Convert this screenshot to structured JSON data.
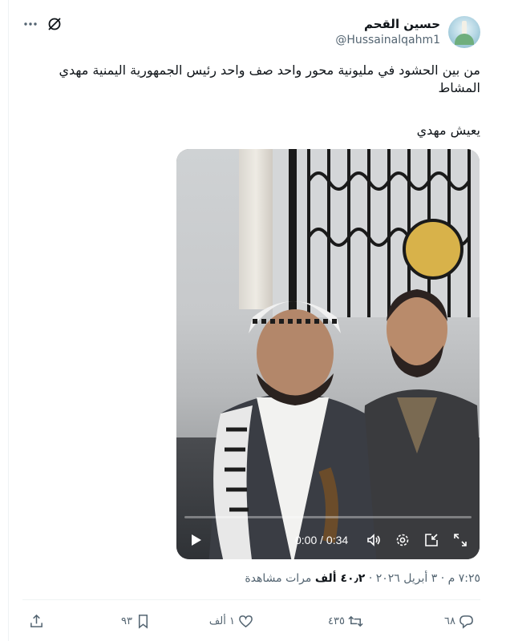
{
  "author": {
    "name": "حسين القحم",
    "handle": "@Hussainalqahm1"
  },
  "post": {
    "text": "من بين الحشود في مليونية محور واحد صف واحد رئيس الجمهورية اليمنية مهدي المشاط",
    "text2": "يعيش مهدي"
  },
  "video": {
    "time": "0:00 / 0:34",
    "progress": 0
  },
  "meta": {
    "timestamp": "٧:٢٥ م · ٣ أبريل ٢٠٢٦ ·",
    "views_count": "٤٠٫٢ ألف",
    "views_label": "مرات مشاهدة"
  },
  "actions": {
    "replies": "٦٨",
    "reposts": "٤٣٥",
    "likes": "١ ألف",
    "bookmarks": "٩٣"
  },
  "icons": [
    "more-icon",
    "grok-icon",
    "play-icon",
    "volume-icon",
    "settings-icon",
    "pip-icon",
    "fullscreen-icon",
    "reply-icon",
    "repost-icon",
    "like-icon",
    "bookmark-icon",
    "share-icon"
  ],
  "colors": {
    "text": "#0f1419",
    "secondary": "#536471",
    "border": "#eff3f4"
  }
}
